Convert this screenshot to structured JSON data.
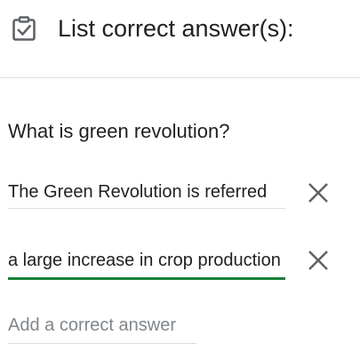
{
  "header": {
    "title": "List correct answer(s):",
    "icon": "assignment-check-icon"
  },
  "question": {
    "text": "What is green revolution?"
  },
  "answers": [
    {
      "value": "The Green Revolution is referred"
    },
    {
      "value": "a large increase in crop production"
    }
  ],
  "add_answer": {
    "placeholder": "Add a correct answer"
  },
  "colors": {
    "accent": "#188038",
    "text": "#202124",
    "icon": "#5f6368",
    "placeholder": "#80868b"
  }
}
